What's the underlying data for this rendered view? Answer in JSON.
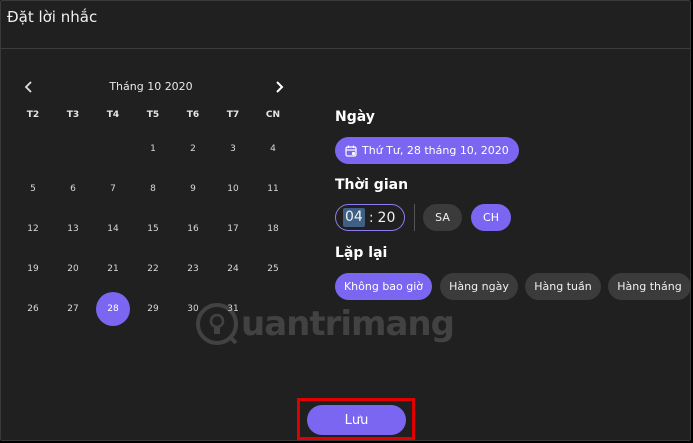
{
  "dialog": {
    "title": "Đặt lời nhắc"
  },
  "calendar": {
    "month_label": "Tháng 10 2020",
    "weekdays": [
      "T2",
      "T3",
      "T4",
      "T5",
      "T6",
      "T7",
      "CN"
    ],
    "weeks": [
      [
        "",
        "",
        "",
        "1",
        "2",
        "3",
        "4"
      ],
      [
        "5",
        "6",
        "7",
        "8",
        "9",
        "10",
        "11"
      ],
      [
        "12",
        "13",
        "14",
        "15",
        "16",
        "17",
        "18"
      ],
      [
        "19",
        "20",
        "21",
        "22",
        "23",
        "24",
        "25"
      ],
      [
        "26",
        "27",
        "28",
        "29",
        "30",
        "31",
        ""
      ]
    ],
    "selected_day": "28"
  },
  "date_section": {
    "label": "Ngày",
    "value": "Thứ Tư, 28 tháng 10, 2020",
    "icon": "calendar-icon"
  },
  "time_section": {
    "label": "Thời gian",
    "hour": "04",
    "separator": ":",
    "minute": "20",
    "am_label": "SA",
    "pm_label": "CH",
    "selected_period": "CH"
  },
  "repeat_section": {
    "label": "Lặp lại",
    "options": [
      "Không bao giờ",
      "Hàng ngày",
      "Hàng tuần",
      "Hàng tháng"
    ],
    "selected": "Không bao giờ"
  },
  "watermark": {
    "text": "uantrimang"
  },
  "save_label": "Lưu",
  "colors": {
    "accent": "#7a66f0",
    "background": "#202020",
    "chip": "#3b3b3b",
    "highlight_frame": "#e10000"
  }
}
